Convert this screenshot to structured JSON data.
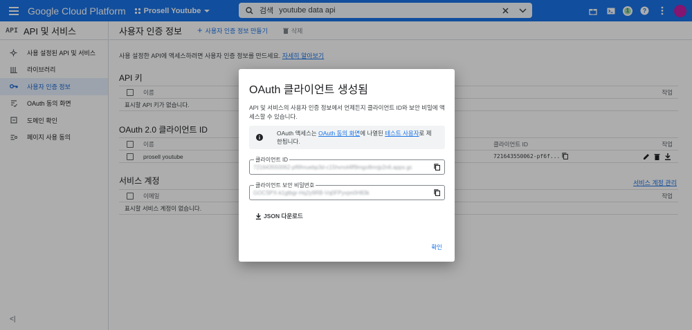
{
  "topbar": {
    "product": "Google Cloud Platform",
    "project": "Prosell Youtube",
    "search_prefix": "검색",
    "search_value": "youtube data api",
    "notification_count": "1"
  },
  "sidebar": {
    "api_icon": "API",
    "title": "API 및 서비스",
    "items": [
      {
        "label": "사용 설정된 API 및 서비스",
        "icon": "dashboard-icon"
      },
      {
        "label": "라이브러리",
        "icon": "library-icon"
      },
      {
        "label": "사용자 인증 정보",
        "icon": "key-icon"
      },
      {
        "label": "OAuth 동의 화면",
        "icon": "consent-icon"
      },
      {
        "label": "도메인 확인",
        "icon": "domain-icon"
      },
      {
        "label": "페이지 사용 동의",
        "icon": "settings-list-icon"
      }
    ],
    "collapse": "<|"
  },
  "main": {
    "title": "사용자 인증 정보",
    "create_label": "사용자 인증 정보 만들기",
    "delete_label": "삭제",
    "intro_text": "사용 설정한 API에 액세스하려면 사용자 인증 정보를 만드세요.",
    "intro_link": "자세히 알아보기",
    "api_keys": {
      "title": "API 키",
      "col_name": "이름",
      "col_action": "작업",
      "empty": "표시할 API 키가 없습니다."
    },
    "oauth": {
      "title": "OAuth 2.0 클라이언트 ID",
      "col_name": "이름",
      "col_client_id": "클라이언트 ID",
      "col_action": "작업",
      "row_name": "prosell youtube",
      "row_client_id": "721643550062-pf6f..."
    },
    "service_accounts": {
      "title": "서비스 계정",
      "manage_link": "서비스 계정 관리",
      "col_email": "이메일",
      "col_action": "작업",
      "empty": "표시할 서비스 계정이 없습니다."
    }
  },
  "dialog": {
    "title": "OAuth 클라이언트 생성됨",
    "description": "API 및 서비스의 사용자 인증 정보에서 언제든지 클라이언트 ID와 보안 비밀에 액세스할 수 있습니다.",
    "info_pre": "OAuth 액세스는 ",
    "info_link1": "OAuth 동의 화면",
    "info_mid": "에 나열된 ",
    "info_link2": "테스트 사용자",
    "info_post": "로 제한됩니다.",
    "client_id_label": "클라이언트 ID",
    "client_id_value": "721643550062-pf6fmuebp3d-c15hvnol4ff9mgo8mrjp2n6.apps.gc",
    "secret_label": "클라이언트 보안 비밀번호",
    "secret_value": "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3k",
    "json_download": "JSON 다운로드",
    "ok": "확인"
  }
}
